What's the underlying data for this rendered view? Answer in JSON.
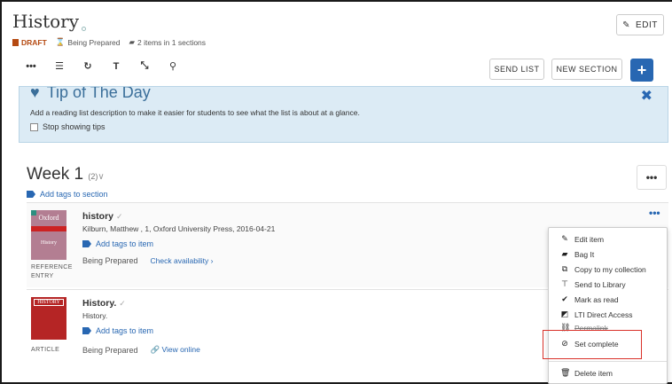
{
  "header": {
    "title": "History",
    "edit_label": "EDIT",
    "draft_label": "DRAFT",
    "status_label": "Being Prepared",
    "items_summary": "2 items in 1 sections"
  },
  "toolbar": {
    "send_list_label": "SEND LIST",
    "new_section_label": "NEW SECTION",
    "add_label": "+"
  },
  "tip": {
    "heading": "Tip of The Day",
    "text": "Add a reading list description to make it easier for students to see what the list is about at a glance.",
    "checkbox_label": "Stop showing tips"
  },
  "section": {
    "title": "Week 1",
    "count": "(2)",
    "add_tags_label": "Add tags to section"
  },
  "items": [
    {
      "title": "history",
      "citation": "Kilburn, Matthew , 1, Oxford University Press, 2016-04-21",
      "add_tags_label": "Add tags to item",
      "type_line1": "REFERENCE",
      "type_line2": "ENTRY",
      "status": "Being Prepared",
      "link_label": "Check availability",
      "cover_publisher": "Oxford",
      "cover_title": "History"
    },
    {
      "title": "History.",
      "citation": "History.",
      "add_tags_label": "Add tags to item",
      "type_line1": "ARTICLE",
      "status": "Being Prepared",
      "link_label": "View online",
      "cover_title": "HISTORY"
    }
  ],
  "menu": {
    "items": [
      {
        "label": "Edit item",
        "icon": "pencil-icon"
      },
      {
        "label": "Bag It",
        "icon": "bag-icon"
      },
      {
        "label": "Copy to my collection",
        "icon": "copy-icon"
      },
      {
        "label": "Send to Library",
        "icon": "pin-icon"
      },
      {
        "label": "Mark as read",
        "icon": "check-icon"
      },
      {
        "label": "LTI Direct Access",
        "icon": "external-icon"
      },
      {
        "label": "Permalink",
        "icon": "link-icon"
      },
      {
        "label": "Set complete",
        "icon": "check-circle-icon"
      },
      {
        "label": "Delete item",
        "icon": "trash-icon"
      }
    ]
  },
  "colors": {
    "accent": "#2867b2",
    "draft": "#b54a12",
    "tip_bg": "#dcebf5",
    "highlight": "#d9322a"
  }
}
